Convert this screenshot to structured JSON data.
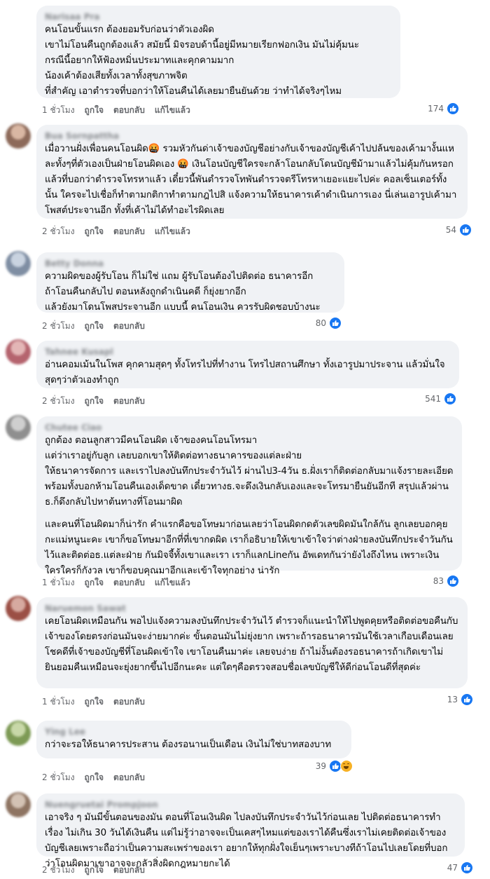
{
  "colors": {
    "like": "#1877f2",
    "haha": "#f7b125",
    "bubble": "#f0f2f5",
    "meta": "#65676b"
  },
  "actions": {
    "like": "ถูกใจ",
    "reply": "ตอบกลับ",
    "edited": "แก้ไขแล้ว"
  },
  "comments": [
    {
      "author": "Narisaa Pra",
      "paras": [
        "คนโอนขั้นแรก ต้องยอมรับก่อนว่าตัวเองผิด\nเขาไม่โอนคืนถูกต้องแล้ว สมัยนี้ มิจรอบด้านี้อยู่มีหมายเรียกฟอกเงิน มันไม่คุ้มนะ\nกรณีนี้อยากให้ฟ้องหมิ่นประมาทและคุกคามมาก\nน้องเค้าต้องเสียทั้งเวลาทั้งสุขภาพจิต\nที่สำคัญ เอาตำรวจที่บอกว่าให้โอนคืนได้เลยมายืนยันด้วย ว่าทำได้จริงๆไหม"
      ],
      "time": "1 ชั่วโมง",
      "edited": true,
      "count": "174",
      "icons": [
        "like-icon"
      ]
    },
    {
      "author": "Bua Sornpattha",
      "paras": [
        "เมื่อวานฝั่งเพื่อนคนโอนผิด🤬 รวมหัวกันด่าเจ้าของบัญชีอย่างกับเจ้าของบัญชีเค้าไปปล้นของเค้ามางั้นแหละทั้งๆที่ตัวเองเป็นฝ่ายโอนผิดเอง 🤬 เงินโอนบัญชีใครจะกล้าโอนกลับโดนบัญชีม้ามาแล้วไม่คุ้มกันหรอกแล้วที่บอกว่าตำรวจโทรหาแล้ว เดี๋ยวนี้พันตำรวจโทพันตำรวจตรีโทรหาเยอะแยะไปค่ะ คอลเซ็นเตอร์ทั้งนั้น ใครจะไปเชื่อก็ทำตามกติกาทำตามกฎไปสิ แจ้งความให้ธนาคารเค้าดำเนินการเอง นี่เล่นเอารูปเค้ามาโพสต์ประจานอีก ทั้งที่เค้าไม่ได้ทำอะไรผิดเลย"
      ],
      "time": "2 ชั่วโมง",
      "edited": true,
      "count": "54",
      "icons": [
        "like-icon"
      ]
    },
    {
      "author": "Betty Donna",
      "paras": [
        "ความผิดของผู้รับโอน ก็ไม่ใช่ แถม ผู้รับโอนต้องไปติดต่อ ธนาคารอีก\nถ้าโอนคืนกลับไป ตอนหลังถูกดำเนินคดี ก็ยุ่งยากอีก\nแล้วยังมาโดนโพสประจานอีก แบบนี้ คนโอนเงิน ควรรับผิดชอบบ้างนะ"
      ],
      "time": "2 ชั่วโมง",
      "edited": false,
      "count": "80",
      "icons": [
        "like-icon"
      ]
    },
    {
      "author": "Tahnee Kusapl",
      "paras": [
        "อ่านคอมเม้นในโพส คุกคามสุดๆ ทั้งโทรไปที่ทำงาน โทรไปสถานศึกษา ทั้งเอารูปมาประจาน แล้วมั่นใจสุดๆว่าตัวเองทำถูก"
      ],
      "time": "2 ชั่วโมง",
      "edited": false,
      "count": "541",
      "icons": [
        "like-icon"
      ]
    },
    {
      "author": "Chutee Ciao",
      "paras": [
        "ถูกต้อง ตอนลูกสาวมีคนโอนผิด เจ้าของคนโอนโทรมา\nแต่ว่าเราอยู่กับลูก เลยบอกเขาให้ติดต่อทางธนาคารของแต่ละฝ่าย\nให้ธนาคารจัดการ และเราไปลงบันทึกประจำวันไว้ ผ่านไป3-4วัน ธ.ฝั่งเราก็ติดต่อกลับมาแจ้งรายละเอียด พร้อมทั้งบอกห้ามโอนคืนเองเด็ดขาด เดี๋ยวทางธ.จะดึงเงินกลับเองและจะโทรมายืนยันอีกที สรุปแล้วผ่านธ.ก็ดึงกลับไปหาต้นทางที่โอนมาผิด",
        "และคนที่โอนผิดมาก็น่ารัก คำแรกคือขอโทษมาก่อนเลยว่าโอนผิดกดตัวเลขผิดมันใกล้กัน ลูกเลยบอกคุยกะแม่หนูนะคะ เขาก็ขอโทษมาอีกที่ที่เขากดผิด เราก็อธิบายให้เขาเข้าใจว่าต่างฝ่ายลงบันทึกประจำวันกันไว้และติดต่อธ.แต่ละฝ่าย กันมิจจี้ทั้งเขาและเรา เราก็แลกLineกัน อัพเดทกันว่ายังไงถึงไหน เพราะเงินใครใครก็กังวล เขาก็ขอบคุณมาอีกและเข้าใจทุกอย่าง น่ารัก"
      ],
      "time": "1 ชั่วโมง",
      "edited": true,
      "count": "83",
      "icons": [
        "like-icon"
      ]
    },
    {
      "author": "Naruemon Sawat",
      "paras": [
        "เคยโอนผิดเหมือนกัน พอไปแจ้งความลงบันทึกประจำวันไว้ ตำรวจก็แนะนำให้ไปพูดคุยหรือติดต่อขอคืนกับเจ้าของโดยตรงก่อนมันจะง่ายมากค่ะ ขั้นตอนมันไม่ยุ่งยาก เพราะถ้ารอธนาคารมันใช้เวลาเกือบเดือนเลย โชคดีที่เจ้าของบัญชีที่โอนผิดเข้าใจ เขาโอนคืนมาค่ะ เลยจบง่าย ถ้าไม่งั้นต้องรอธนาคารถ้าเกิดเขาไม่ยินยอมคืนเหมือนจะยุ่งยากขึ้นไปอีกนะคะ แต่ใดๆคือตรวจสอบชื่อเลขบัญชีให้ดีก่อนโอนดีที่สุดค่ะ"
      ],
      "time": "1 ชั่วโมง",
      "edited": false,
      "count": "13",
      "icons": [
        "like-icon"
      ]
    },
    {
      "author": "Ying Lee",
      "paras": [
        "กว่าจะรอให้ธนาคารประสาน ต้องรอนานเป็นเดือน เงินไม่ใช่บาทสองบาท"
      ],
      "time": "2 ชั่วโมง",
      "edited": false,
      "count": "39",
      "icons": [
        "like-icon",
        "haha-icon"
      ]
    },
    {
      "author": "Nuengruetai Prompjoon",
      "paras": [
        "เอาจริง ๆ มันมีขั้นตอนของมัน ตอนที่โอนเงินผิด ไปลงบันทึกประจำวันไว้ก่อนเลย ไปติดต่อธนาคารทำเรื่อง ไม่เกิน 30 วันได้เงินคืน แต่ไม่รู้ว่าอาจจะเป็นเคสๆไหมแต่ของเราได้คืนซึ่งเราไม่เคยติดต่อเจ้าของบัญชีเลยเพราะถือว่าเป็นความสะเพร่าของเรา อยากให้ทุกฝั่งใจเย็นๆเพราะบางทีถ้าโอนไปเลยโดยที่บอกว่าโอนผิดมาเขาอาจจะกลัวสิ่งผิดกฎหมายกะได้"
      ],
      "time": "2 ชั่วโมง",
      "edited": false,
      "count": "47",
      "icons": [
        "like-icon"
      ]
    }
  ]
}
